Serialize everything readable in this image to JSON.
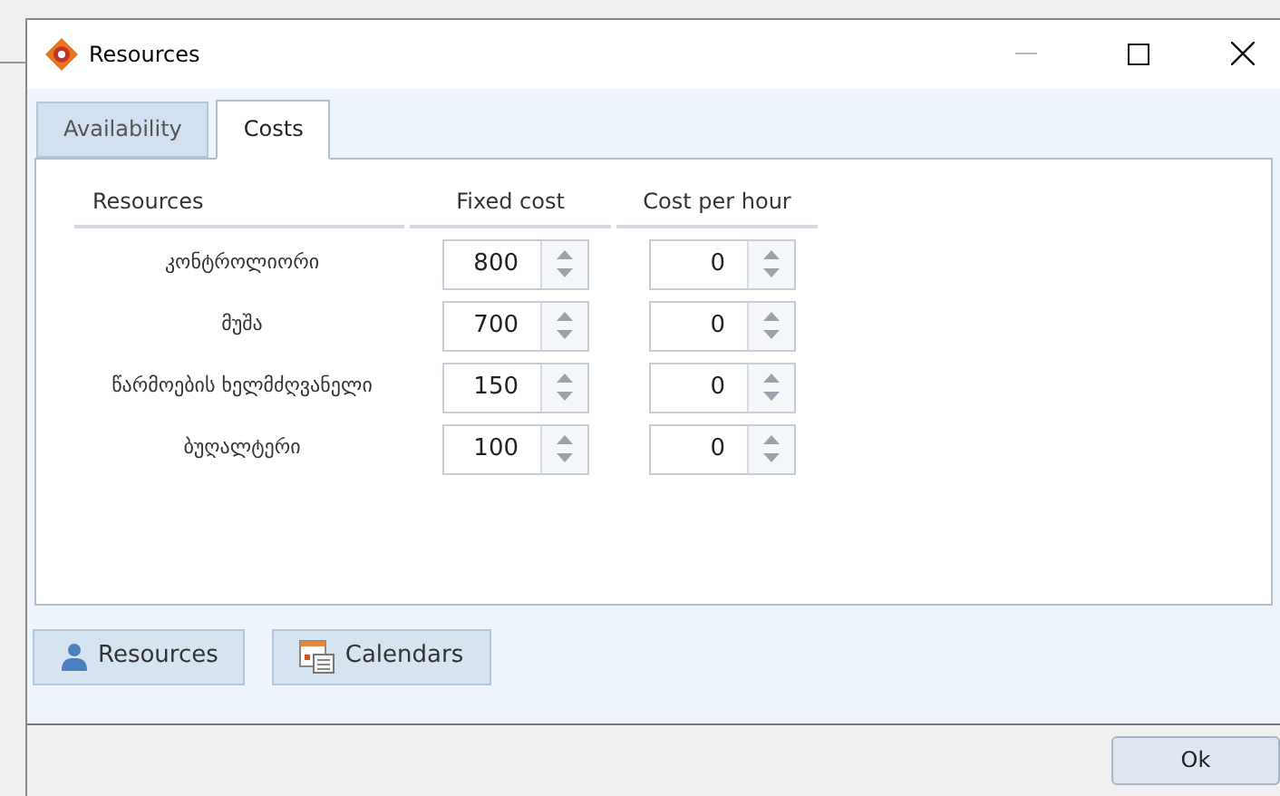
{
  "window": {
    "title": "Resources"
  },
  "tabs": [
    {
      "label": "Availability",
      "selected": false
    },
    {
      "label": "Costs",
      "selected": true
    }
  ],
  "table": {
    "columns": [
      "Resources",
      "Fixed cost",
      "Cost per hour"
    ],
    "rows": [
      {
        "name": "კონტროლიორი",
        "fixed_cost": "800",
        "cost_per_hour": "0"
      },
      {
        "name": "მუშა",
        "fixed_cost": "700",
        "cost_per_hour": "0"
      },
      {
        "name": "წარმოების ხელმძღვანელი",
        "fixed_cost": "150",
        "cost_per_hour": "0"
      },
      {
        "name": "ბუღალტერი",
        "fixed_cost": "100",
        "cost_per_hour": "0"
      }
    ]
  },
  "buttons": [
    {
      "label": "Resources",
      "kind": "person"
    },
    {
      "label": "Calendars",
      "kind": "calendar"
    }
  ],
  "footer": {
    "ok": "Ok"
  }
}
